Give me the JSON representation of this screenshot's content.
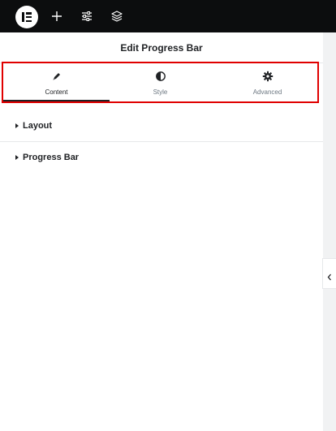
{
  "topbar": {
    "logo_icon": "elementor-logo-icon",
    "icons": [
      "plus-icon",
      "sliders-icon",
      "layers-icon"
    ]
  },
  "panel": {
    "title": "Edit Progress Bar"
  },
  "tabs": [
    {
      "label": "Content",
      "icon": "pencil-icon",
      "active": true
    },
    {
      "label": "Style",
      "icon": "half-circle-icon",
      "active": false
    },
    {
      "label": "Advanced",
      "icon": "gear-icon",
      "active": false
    }
  ],
  "sections": [
    {
      "label": "Layout",
      "expanded": false
    },
    {
      "label": "Progress Bar",
      "expanded": false
    }
  ],
  "colors": {
    "topbar_bg": "#0c0d0e",
    "highlight_border": "#e00000",
    "text": "#1f2124",
    "muted_text": "#6d7882"
  },
  "collapse_handle": {
    "icon": "chevron-left-icon"
  }
}
